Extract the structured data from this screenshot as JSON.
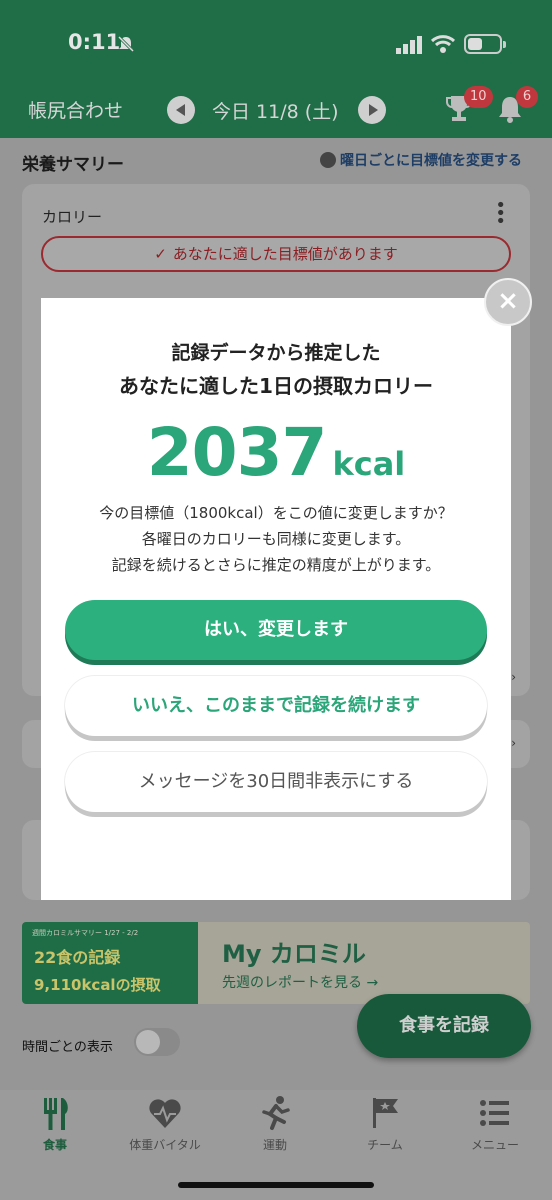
{
  "status_bar": {
    "time": "0:11"
  },
  "header": {
    "title": "帳尻合わせ",
    "date": "今日 11/8 (土)",
    "trophy_badge": "10",
    "bell_badge": "6"
  },
  "page": {
    "section_title": "栄養サマリー",
    "goal_link": "曜日ごとに目標値を変更する",
    "card_title": "カロリー",
    "alert_pill": "あなたに適した目標値があります",
    "banner": {
      "sub": "週間カロミルサマリー 1/27 - 2/2",
      "meals": "22食の記録",
      "kcal": "9,110kcalの摂取",
      "title": "My カロミル",
      "link": "先週のレポートを見る →"
    },
    "toggle_label": "時間ごとの表示",
    "fab_label": "食事を記録"
  },
  "modal": {
    "title_line1": "記録データから推定した",
    "title_line2": "あなたに適した1日の摂取カロリー",
    "value": "2037",
    "unit": "kcal",
    "desc_line1": "今の目標値（1800kcal）をこの値に変更しますか？",
    "desc_line2": "各曜日のカロリーも同様に変更します。",
    "desc_line3": "記録を続けるとさらに推定の精度が上がります。",
    "btn_yes": "はい、変更します",
    "btn_no": "いいえ、このままで記録を続けます",
    "btn_hide": "メッセージを30日間非表示にする",
    "close": "×"
  },
  "tabs": [
    {
      "label": "食事",
      "icon": "fork-knife-icon",
      "active": true
    },
    {
      "label": "体重バイタル",
      "icon": "heart-icon",
      "active": false
    },
    {
      "label": "運動",
      "icon": "runner-icon",
      "active": false
    },
    {
      "label": "チーム",
      "icon": "flag-icon",
      "active": false
    },
    {
      "label": "メニュー",
      "icon": "list-icon",
      "active": false
    }
  ],
  "colors": {
    "brand_green": "#2bb07e",
    "header_green": "#1f6e47",
    "alert_red": "#c0383d"
  }
}
